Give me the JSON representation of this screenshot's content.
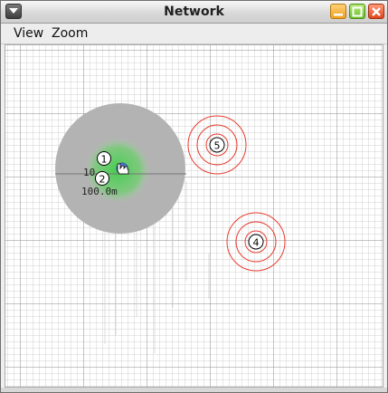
{
  "window": {
    "title": "Network"
  },
  "menubar": {
    "items": [
      {
        "label": "View"
      },
      {
        "label": "Zoom"
      }
    ]
  },
  "nodes": [
    {
      "id": "1",
      "label": "1"
    },
    {
      "id": "2",
      "label": "2"
    },
    {
      "id": "4",
      "label": "4"
    },
    {
      "id": "5",
      "label": "5"
    }
  ],
  "labels": {
    "distance_partial": "10",
    "distance_full": "100.0m"
  },
  "colors": {
    "range_gray": "#b3b3b3",
    "range_green": "#55cf5a",
    "interference_red": "#e83b2e",
    "grid": "#b9b9b9"
  },
  "icons": {
    "window_menu": "down-triangle-icon",
    "minimize": "minimize-icon",
    "maximize": "maximize-icon",
    "close": "close-icon"
  }
}
